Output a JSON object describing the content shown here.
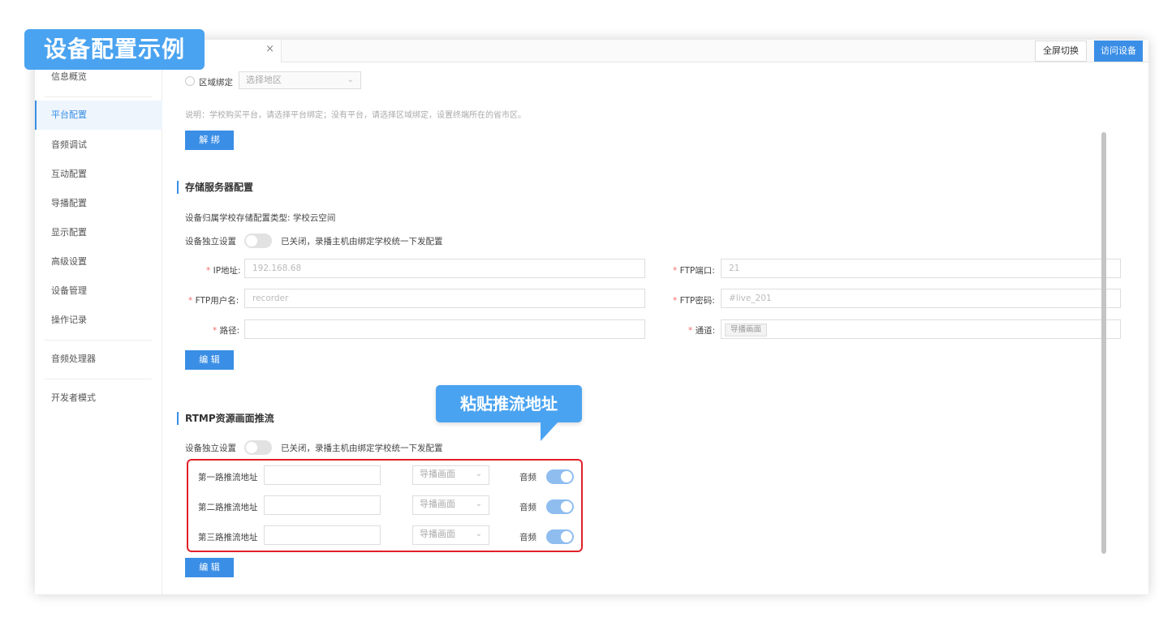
{
  "overlay": {
    "badge_text": "设备配置示例",
    "callout_text": "粘贴推流地址"
  },
  "topbar": {
    "close_glyph": "×",
    "fullscreen_label": "全屏切换",
    "visit_label": "访问设备"
  },
  "sidebar": {
    "items": [
      {
        "label": "信息概览"
      },
      {
        "label": "平台配置"
      },
      {
        "label": "音频调试"
      },
      {
        "label": "互动配置"
      },
      {
        "label": "导播配置"
      },
      {
        "label": "显示配置"
      },
      {
        "label": "高级设置"
      },
      {
        "label": "设备管理"
      },
      {
        "label": "操作记录"
      },
      {
        "label": "音频处理器"
      },
      {
        "label": "开发者模式"
      }
    ],
    "active_index": 1
  },
  "platform": {
    "region_label": "区域绑定",
    "region_placeholder": "选择地区",
    "note": "说明：学校购买平台，请选择平台绑定；没有平台，请选择区域绑定，设置终端所在的省市区。",
    "unbind_label": "解 绑"
  },
  "storage": {
    "title": "存储服务器配置",
    "type_text": "设备归属学校存储配置类型: 学校云空间",
    "independent_label": "设备独立设置",
    "toggle_text": "已关闭，录播主机由绑定学校统一下发配置",
    "required_mark": "*",
    "ip_label": "IP地址:",
    "ip_value": "192.168.68",
    "ftp_port_label": "FTP端口:",
    "ftp_port_value": "21",
    "ftp_user_label": "FTP用户名:",
    "ftp_user_value": "recorder",
    "ftp_pwd_label": "FTP密码:",
    "ftp_pwd_value": "#live_201",
    "path_label": "路径:",
    "path_value": "",
    "channel_label": "通道:",
    "channel_tag": "导播画面",
    "edit_label": "编 辑"
  },
  "rtmp": {
    "title": "RTMP资源画面推流",
    "independent_label": "设备独立设置",
    "toggle_text": "已关闭，录播主机由绑定学校统一下发配置",
    "rows": [
      {
        "label": "第一路推流地址",
        "url": "",
        "source": "导播画面",
        "audio_label": "音频"
      },
      {
        "label": "第二路推流地址",
        "url": "",
        "source": "导播画面",
        "audio_label": "音频"
      },
      {
        "label": "第三路推流地址",
        "url": "",
        "source": "导播画面",
        "audio_label": "音频"
      }
    ],
    "edit_label": "编 辑"
  },
  "colors": {
    "accent": "#3a8ee6",
    "badge": "#4aa3f0",
    "highlight_border": "#e0202a"
  }
}
